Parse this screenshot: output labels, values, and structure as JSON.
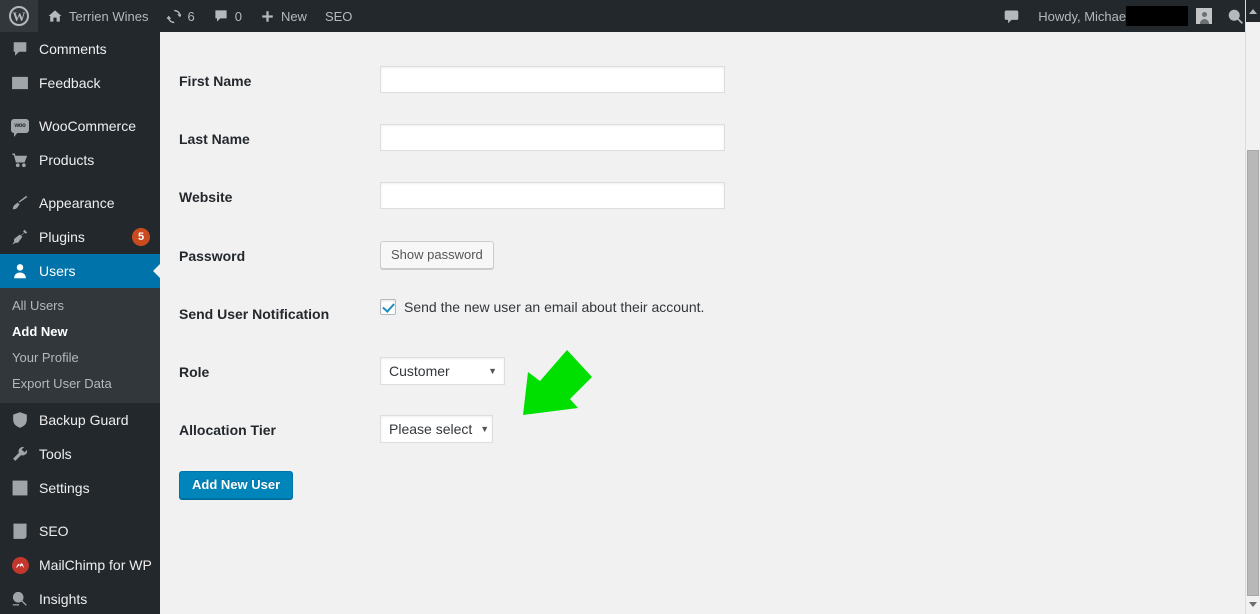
{
  "adminbar": {
    "logo_icon": "wordpress-logo-icon",
    "site_name": "Terrien Wines",
    "home_icon": "home-icon",
    "updates_icon": "updates-icon",
    "updates_count": "6",
    "comments_icon": "comment-bubble-icon",
    "comments_count": "0",
    "new_icon": "plus-icon",
    "new_label": "New",
    "seo_label": "SEO",
    "notifications_icon": "speech-bubble-icon",
    "howdy_label": "Howdy, Michael",
    "avatar_icon": "user-avatar-icon",
    "search_icon": "search-icon"
  },
  "sidebar": {
    "items": [
      {
        "label": "Comments",
        "icon": "comment-bubble-icon",
        "current": false,
        "badge": ""
      },
      {
        "label": "Feedback",
        "icon": "feedback-list-icon",
        "current": false,
        "badge": ""
      },
      {
        "label": "WooCommerce",
        "icon": "woocommerce-icon",
        "current": false,
        "badge": ""
      },
      {
        "label": "Products",
        "icon": "shopping-cart-icon",
        "current": false,
        "badge": ""
      },
      {
        "label": "Appearance",
        "icon": "paintbrush-icon",
        "current": false,
        "badge": ""
      },
      {
        "label": "Plugins",
        "icon": "plug-icon",
        "current": false,
        "badge": "5"
      },
      {
        "label": "Users",
        "icon": "user-icon",
        "current": true,
        "badge": ""
      },
      {
        "label": "Backup Guard",
        "icon": "shield-icon",
        "current": false,
        "badge": ""
      },
      {
        "label": "Tools",
        "icon": "wrench-icon",
        "current": false,
        "badge": ""
      },
      {
        "label": "Settings",
        "icon": "sliders-icon",
        "current": false,
        "badge": ""
      },
      {
        "label": "SEO",
        "icon": "yoast-seo-icon",
        "current": false,
        "badge": ""
      },
      {
        "label": "MailChimp for WP",
        "icon": "mailchimp-icon",
        "current": false,
        "badge": ""
      },
      {
        "label": "Insights",
        "icon": "insights-icon",
        "current": false,
        "badge": ""
      }
    ],
    "users_submenu": [
      {
        "label": "All Users",
        "current": false
      },
      {
        "label": "Add New",
        "current": true
      },
      {
        "label": "Your Profile",
        "current": false
      },
      {
        "label": "Export User Data",
        "current": false
      }
    ]
  },
  "form": {
    "first_name": {
      "label": "First Name",
      "value": ""
    },
    "last_name": {
      "label": "Last Name",
      "value": ""
    },
    "website": {
      "label": "Website",
      "value": ""
    },
    "password": {
      "label": "Password",
      "button_label": "Show password"
    },
    "notification": {
      "label": "Send User Notification",
      "checkbox_label": "Send the new user an email about their account.",
      "checked": true
    },
    "role": {
      "label": "Role",
      "selected": "Customer",
      "caret_icon": "chevron-down-icon"
    },
    "allocation_tier": {
      "label": "Allocation Tier",
      "selected": "Please select",
      "caret_icon": "chevron-down-icon"
    },
    "submit_label": "Add New User"
  },
  "annotation": {
    "arrow_icon": "green-arrow-pointing-down-left",
    "color": "#00e000"
  },
  "scrollbar": {
    "up_icon": "scroll-up-arrow-icon",
    "down_icon": "scroll-down-arrow-icon",
    "thumb": "scrollbar-thumb"
  },
  "colors": {
    "adminbar_bg": "#23282d",
    "sidebar_bg": "#23282d",
    "submenu_bg": "#32373c",
    "active_blue": "#0073aa",
    "primary_button": "#0085ba",
    "badge_orange": "#ca4a1f",
    "content_bg": "#f1f1f1",
    "annotation_green": "#00e000"
  }
}
